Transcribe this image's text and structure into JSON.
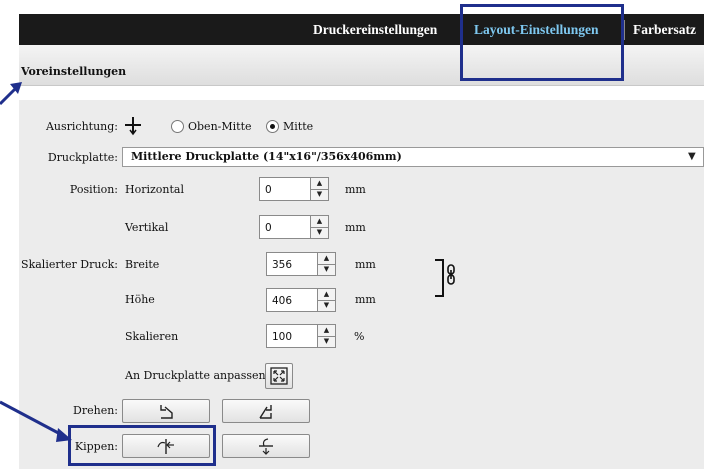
{
  "tabs": [
    {
      "label": "Druckereinstellungen",
      "active": false
    },
    {
      "label": "Layout-Einstellungen",
      "active": true
    },
    {
      "label": "Farbersatz",
      "active": false
    }
  ],
  "presets": {
    "label": "Voreinstellungen"
  },
  "orientation": {
    "label": "Ausrichtung:",
    "options": [
      {
        "label": "Oben-Mitte",
        "selected": false
      },
      {
        "label": "Mitte",
        "selected": true
      }
    ]
  },
  "platen": {
    "label": "Druckplatte:",
    "value": "Mittlere Druckplatte (14\"x16\"/356x406mm)"
  },
  "position": {
    "label": "Position:",
    "horizontal": {
      "label": "Horizontal",
      "value": "0",
      "unit": "mm"
    },
    "vertical": {
      "label": "Vertikal",
      "value": "0",
      "unit": "mm"
    }
  },
  "scaled_print": {
    "label": "Skalierter Druck:",
    "width": {
      "label": "Breite",
      "value": "356",
      "unit": "mm"
    },
    "height": {
      "label": "Höhe",
      "value": "406",
      "unit": "mm"
    },
    "scale": {
      "label": "Skalieren",
      "value": "100",
      "unit": "%"
    },
    "fit_label": "An Druckplatte anpassen"
  },
  "rotate": {
    "label": "Drehen:"
  },
  "flip": {
    "label": "Kippen:"
  },
  "colors": {
    "highlight": "#1f2f8c",
    "active_tab": "#7ec8f0",
    "header": "#1a1a1a"
  },
  "icons": [
    "alignment-cross-icon",
    "chain-link-icon",
    "fit-to-platen-icon",
    "rotate-left-icon",
    "rotate-right-icon",
    "flip-horizontal-icon",
    "flip-vertical-icon"
  ]
}
